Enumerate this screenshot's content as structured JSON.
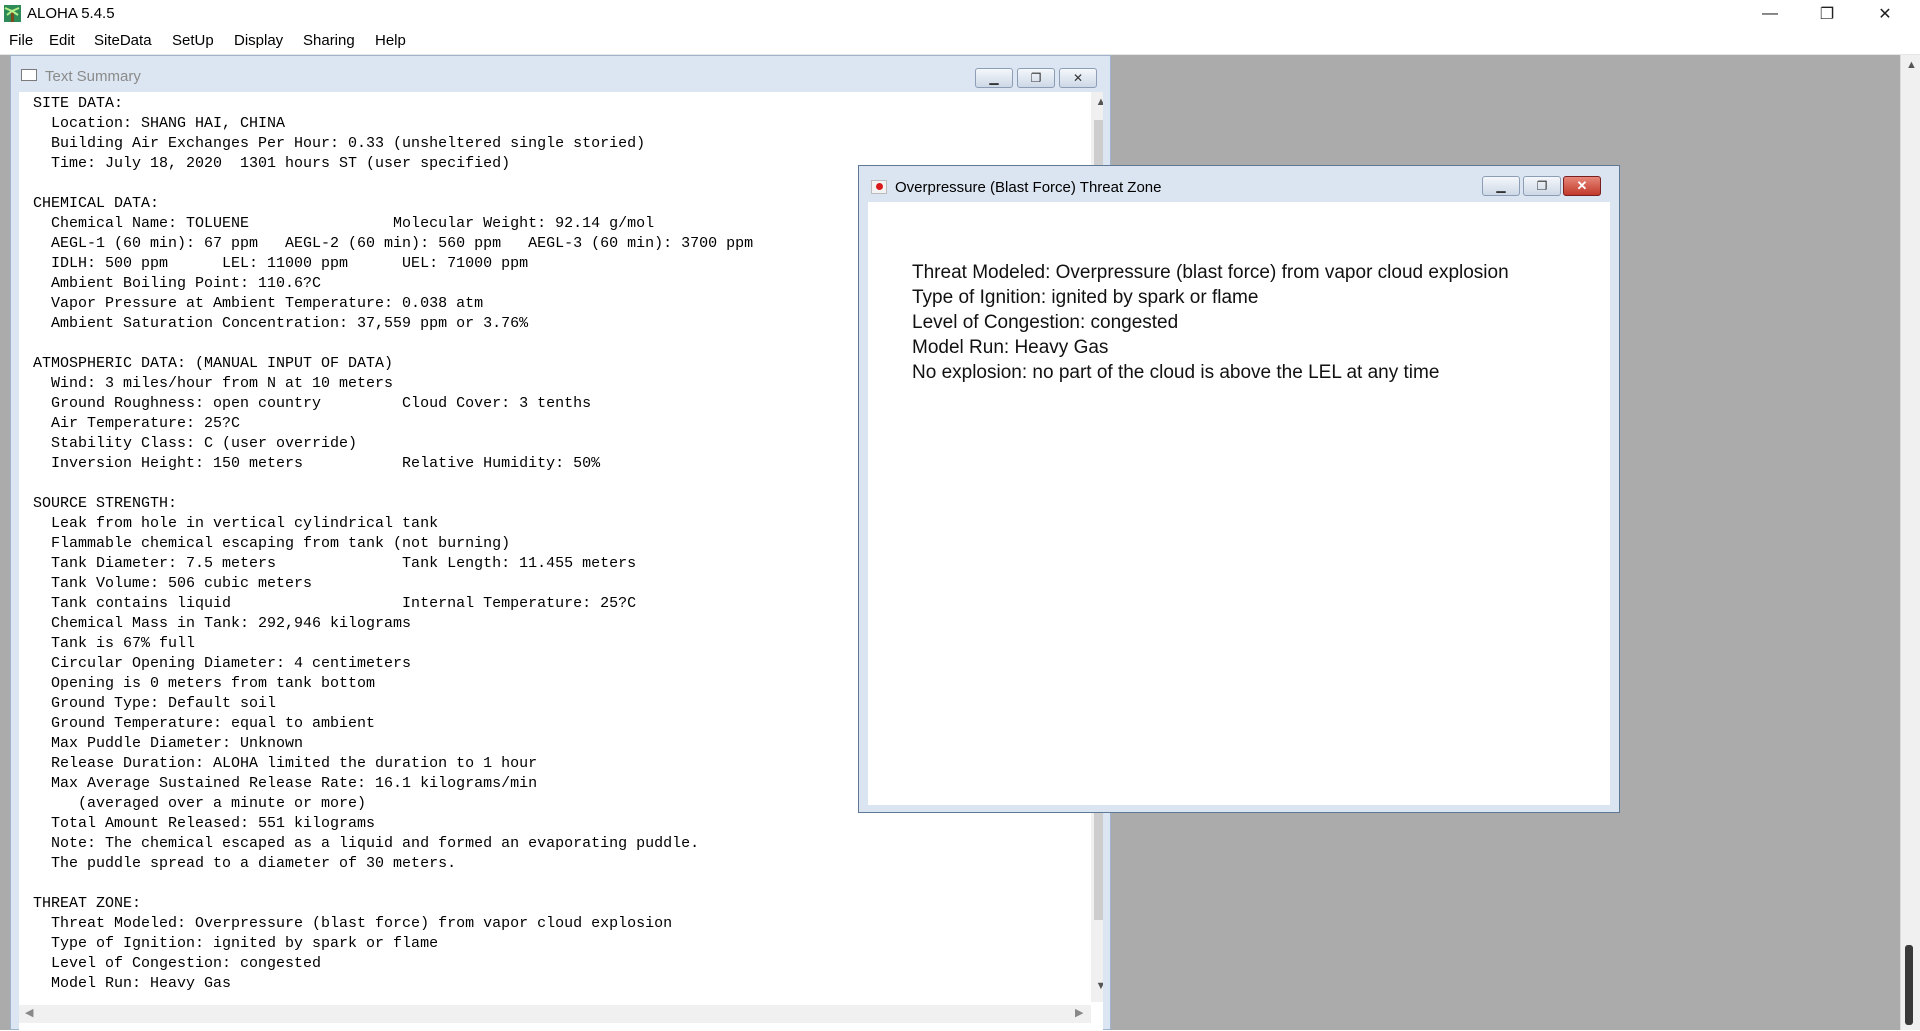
{
  "app": {
    "title": "ALOHA 5.4.5",
    "minimize": "—",
    "restore": "❐",
    "close": "✕"
  },
  "menu": {
    "items": [
      "File",
      "Edit",
      "SiteData",
      "SetUp",
      "Display",
      "Sharing",
      "Help"
    ]
  },
  "text_summary": {
    "title": "Text Summary",
    "lines": [
      "SITE DATA:",
      "  Location: SHANG HAI, CHINA",
      "  Building Air Exchanges Per Hour: 0.33 (unsheltered single storied)",
      "  Time: July 18, 2020  1301 hours ST (user specified)",
      "",
      "CHEMICAL DATA:",
      "  Chemical Name: TOLUENE                Molecular Weight: 92.14 g/mol",
      "  AEGL-1 (60 min): 67 ppm   AEGL-2 (60 min): 560 ppm   AEGL-3 (60 min): 3700 ppm",
      "  IDLH: 500 ppm      LEL: 11000 ppm      UEL: 71000 ppm",
      "  Ambient Boiling Point: 110.6?C",
      "  Vapor Pressure at Ambient Temperature: 0.038 atm",
      "  Ambient Saturation Concentration: 37,559 ppm or 3.76%",
      "",
      "ATMOSPHERIC DATA: (MANUAL INPUT OF DATA)",
      "  Wind: 3 miles/hour from N at 10 meters",
      "  Ground Roughness: open country         Cloud Cover: 3 tenths",
      "  Air Temperature: 25?C",
      "  Stability Class: C (user override)",
      "  Inversion Height: 150 meters           Relative Humidity: 50%",
      "",
      "SOURCE STRENGTH:",
      "  Leak from hole in vertical cylindrical tank",
      "  Flammable chemical escaping from tank (not burning)",
      "  Tank Diameter: 7.5 meters              Tank Length: 11.455 meters",
      "  Tank Volume: 506 cubic meters",
      "  Tank contains liquid                   Internal Temperature: 25?C",
      "  Chemical Mass in Tank: 292,946 kilograms",
      "  Tank is 67% full",
      "  Circular Opening Diameter: 4 centimeters",
      "  Opening is 0 meters from tank bottom",
      "  Ground Type: Default soil",
      "  Ground Temperature: equal to ambient",
      "  Max Puddle Diameter: Unknown",
      "  Release Duration: ALOHA limited the duration to 1 hour",
      "  Max Average Sustained Release Rate: 16.1 kilograms/min",
      "     (averaged over a minute or more)",
      "  Total Amount Released: 551 kilograms",
      "  Note: The chemical escaped as a liquid and formed an evaporating puddle.",
      "  The puddle spread to a diameter of 30 meters.",
      "",
      "THREAT ZONE:",
      "  Threat Modeled: Overpressure (blast force) from vapor cloud explosion",
      "  Type of Ignition: ignited by spark or flame",
      "  Level of Congestion: congested",
      "  Model Run: Heavy Gas"
    ]
  },
  "threat_window": {
    "title": "Overpressure (Blast Force) Threat Zone",
    "lines": [
      "Threat Modeled: Overpressure (blast force) from vapor cloud explosion",
      "Type of Ignition: ignited by spark or flame",
      "Level of Congestion: congested",
      "Model Run: Heavy Gas",
      "No explosion: no part of the cloud is above the LEL at any time"
    ]
  },
  "colors": {
    "mdi_background": "#ababab",
    "close_button": "#c0392b"
  }
}
